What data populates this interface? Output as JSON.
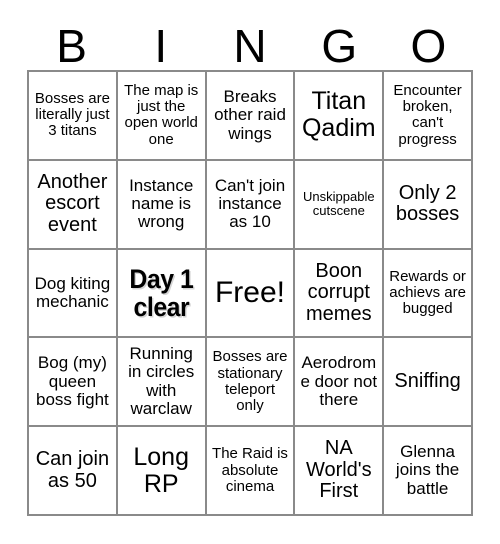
{
  "card": {
    "title": "BINGO",
    "header_letters": [
      "B",
      "I",
      "N",
      "G",
      "O"
    ],
    "colors": {
      "background": "#ffffff",
      "text": "#000000",
      "grid_line": "#8a8a8a",
      "emphasis_shadow": "#d4d4d4"
    },
    "free_space": "Free!",
    "cells": [
      {
        "text": "Bosses are literally just 3 titans",
        "size": "sm",
        "emphasis": false
      },
      {
        "text": "The map is just the open world one",
        "size": "sm",
        "emphasis": false
      },
      {
        "text": "Breaks other raid wings",
        "size": "md",
        "emphasis": false
      },
      {
        "text": "Titan Qadim",
        "size": "xl",
        "emphasis": false
      },
      {
        "text": "Encounter broken, can't progress",
        "size": "sm",
        "emphasis": false
      },
      {
        "text": "Another escort event",
        "size": "lg",
        "emphasis": false
      },
      {
        "text": "Instance name is wrong",
        "size": "md",
        "emphasis": false
      },
      {
        "text": "Can't join instance as 10",
        "size": "md",
        "emphasis": false
      },
      {
        "text": "Unskippable cutscene",
        "size": "xs",
        "emphasis": false
      },
      {
        "text": "Only 2 bosses",
        "size": "lg",
        "emphasis": false
      },
      {
        "text": "Dog kiting mechanic",
        "size": "md",
        "emphasis": false
      },
      {
        "text": "Day 1 clear",
        "size": "xl",
        "emphasis": true
      },
      {
        "text": "Free!",
        "size": "2xl",
        "emphasis": false
      },
      {
        "text": "Boon corrupt memes",
        "size": "lg",
        "emphasis": false
      },
      {
        "text": "Rewards or achievs are bugged",
        "size": "sm",
        "emphasis": false
      },
      {
        "text": "Bog (my) queen boss fight",
        "size": "md",
        "emphasis": false
      },
      {
        "text": "Running in circles with warclaw",
        "size": "md",
        "emphasis": false
      },
      {
        "text": "Bosses are stationary teleport only",
        "size": "sm",
        "emphasis": false
      },
      {
        "text": "Aerodrome door not there",
        "size": "md",
        "emphasis": false
      },
      {
        "text": "Sniffing",
        "size": "lg",
        "emphasis": false
      },
      {
        "text": "Can join as 50",
        "size": "lg",
        "emphasis": false
      },
      {
        "text": "Long RP",
        "size": "xl",
        "emphasis": false
      },
      {
        "text": "The Raid is absolute cinema",
        "size": "sm",
        "emphasis": false
      },
      {
        "text": "NA World's First",
        "size": "lg",
        "emphasis": false
      },
      {
        "text": "Glenna joins the battle",
        "size": "md",
        "emphasis": false
      }
    ]
  }
}
